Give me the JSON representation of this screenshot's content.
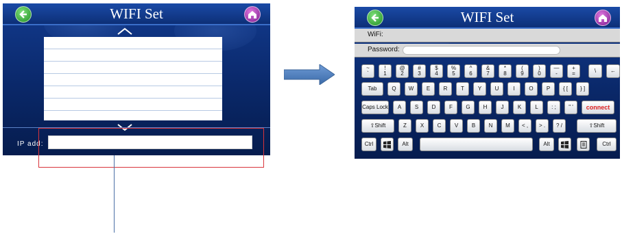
{
  "left_screen": {
    "title": "WIFI Set",
    "ip_label": "IP add:",
    "ip_value": "",
    "ssid_rows": 7
  },
  "right_screen": {
    "title": "WIFI Set",
    "wifi_label": "WiFi:",
    "password_label": "Password:",
    "password_value": ""
  },
  "keyboard": {
    "row1": [
      {
        "top": "~",
        "bottom": "`"
      },
      {
        "top": "!",
        "bottom": "1"
      },
      {
        "top": "@",
        "bottom": "2"
      },
      {
        "top": "#",
        "bottom": "3"
      },
      {
        "top": "$",
        "bottom": "4"
      },
      {
        "top": "%",
        "bottom": "5"
      },
      {
        "top": "^",
        "bottom": "6"
      },
      {
        "top": "&",
        "bottom": "7"
      },
      {
        "top": "*",
        "bottom": "8"
      },
      {
        "top": "(",
        "bottom": "9"
      },
      {
        "top": ")",
        "bottom": "0"
      },
      {
        "top": "—",
        "bottom": "-"
      },
      {
        "top": "+",
        "bottom": "="
      },
      {
        "top": "\\",
        "bottom": ""
      },
      {
        "top": "←",
        "bottom": ""
      }
    ],
    "row2": [
      "Tab",
      "Q",
      "W",
      "E",
      "R",
      "T",
      "Y",
      "U",
      "I",
      "O",
      "P",
      "{ [",
      "} ]"
    ],
    "row3": [
      "Caps Lock",
      "A",
      "S",
      "D",
      "F",
      "G",
      "H",
      "J",
      "K",
      "L",
      ": ;",
      "\" '",
      "connect"
    ],
    "row4": [
      "⇧Shift",
      "Z",
      "X",
      "C",
      "V",
      "B",
      "N",
      "M",
      "< ,",
      "> .",
      "? /",
      "⇧Shift"
    ],
    "row5": [
      "Ctrl",
      "Alt",
      "",
      "Alt",
      "Ctrl"
    ]
  },
  "colors": {
    "panel": "#0a2869",
    "connect": "#e02020",
    "redbox": "#d9343a",
    "arrow": "#4f80bd"
  }
}
